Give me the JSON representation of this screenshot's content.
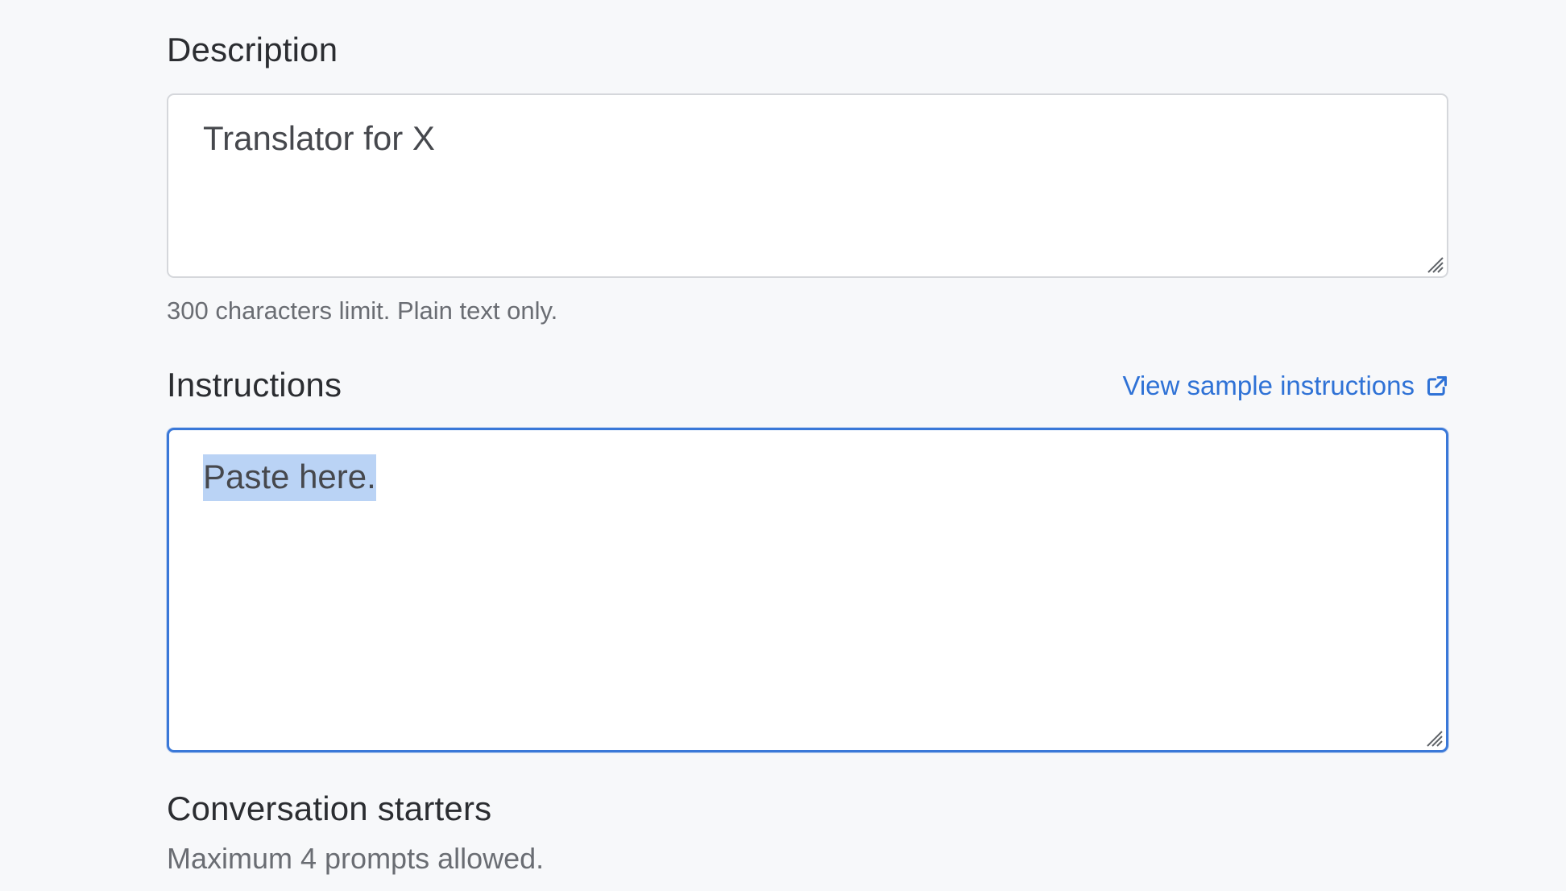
{
  "description": {
    "label": "Description",
    "value": "Translator for X",
    "hint": "300 characters limit. Plain text only."
  },
  "instructions": {
    "label": "Instructions",
    "link_label": "View sample instructions",
    "link_icon": "external-link-icon",
    "value": "Paste here."
  },
  "conversation_starters": {
    "label": "Conversation starters",
    "hint": "Maximum 4 prompts allowed."
  },
  "colors": {
    "accent": "#3a78d8",
    "link": "#2f72d6",
    "selection": "#bad3f5",
    "background": "#f7f8fa"
  }
}
